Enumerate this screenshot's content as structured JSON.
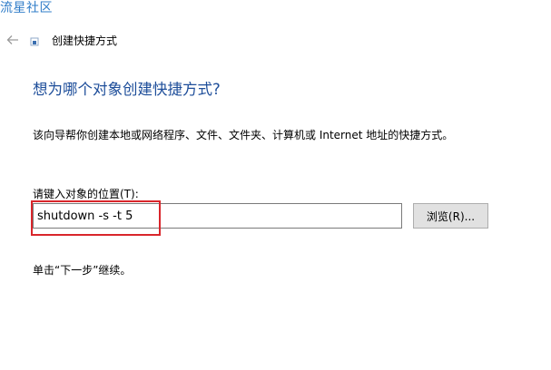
{
  "watermark": "流星社区",
  "window": {
    "title": "创建快捷方式"
  },
  "wizard": {
    "heading": "想为哪个对象创建快捷方式?",
    "description": "该向导帮你创建本地或网络程序、文件、文件夹、计算机或 Internet 地址的快捷方式。",
    "location_label": "请键入对象的位置(T):",
    "location_value": "shutdown -s -t 5",
    "browse_label": "浏览(R)...",
    "hint": "单击“下一步”继续。"
  },
  "colors": {
    "heading": "#1e4e9a",
    "watermark": "#2f7cc8",
    "highlight": "#d9262b",
    "button_bg": "#e1e1e1"
  },
  "icons": {
    "back": "arrow-left-icon",
    "wizard": "shortcut-icon"
  }
}
